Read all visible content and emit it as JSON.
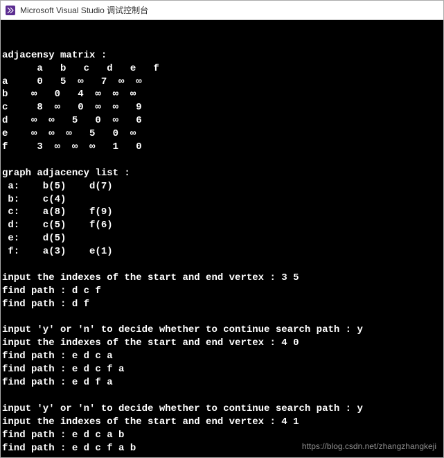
{
  "window": {
    "title": "Microsoft Visual Studio 调试控制台"
  },
  "console": {
    "lines": [
      "adjacensy matrix :",
      "      a   b   c   d   e   f",
      "a     0   5  ∞   7  ∞  ∞",
      "b    ∞   0   4  ∞  ∞  ∞",
      "c     8  ∞   0  ∞  ∞   9",
      "d    ∞  ∞   5   0  ∞   6",
      "e    ∞  ∞  ∞   5   0  ∞",
      "f     3  ∞  ∞  ∞   1   0",
      "",
      "graph adjacency list :",
      " a:    b(5)    d(7)",
      " b:    c(4)",
      " c:    a(8)    f(9)",
      " d:    c(5)    f(6)",
      " e:    d(5)",
      " f:    a(3)    e(1)",
      "",
      "input the indexes of the start and end vertex : 3 5",
      "find path : d c f",
      "find path : d f",
      "",
      "input 'y' or 'n' to decide whether to continue search path : y",
      "input the indexes of the start and end vertex : 4 0",
      "find path : e d c a",
      "find path : e d c f a",
      "find path : e d f a",
      "",
      "input 'y' or 'n' to decide whether to continue search path : y",
      "input the indexes of the start and end vertex : 4 1",
      "find path : e d c a b",
      "find path : e d c f a b"
    ]
  },
  "watermark": {
    "text": "https://blog.csdn.net/zhangzhangkeji"
  },
  "chart_data": {
    "type": "table",
    "adjacency_matrix": {
      "vertices": [
        "a",
        "b",
        "c",
        "d",
        "e",
        "f"
      ],
      "rows": [
        {
          "vertex": "a",
          "values": [
            0,
            5,
            "∞",
            7,
            "∞",
            "∞"
          ]
        },
        {
          "vertex": "b",
          "values": [
            "∞",
            0,
            4,
            "∞",
            "∞",
            "∞"
          ]
        },
        {
          "vertex": "c",
          "values": [
            8,
            "∞",
            0,
            "∞",
            "∞",
            9
          ]
        },
        {
          "vertex": "d",
          "values": [
            "∞",
            "∞",
            5,
            0,
            "∞",
            6
          ]
        },
        {
          "vertex": "e",
          "values": [
            "∞",
            "∞",
            "∞",
            5,
            0,
            "∞"
          ]
        },
        {
          "vertex": "f",
          "values": [
            3,
            "∞",
            "∞",
            "∞",
            1,
            0
          ]
        }
      ]
    },
    "adjacency_list": {
      "a": [
        {
          "to": "b",
          "w": 5
        },
        {
          "to": "d",
          "w": 7
        }
      ],
      "b": [
        {
          "to": "c",
          "w": 4
        }
      ],
      "c": [
        {
          "to": "a",
          "w": 8
        },
        {
          "to": "f",
          "w": 9
        }
      ],
      "d": [
        {
          "to": "c",
          "w": 5
        },
        {
          "to": "f",
          "w": 6
        }
      ],
      "e": [
        {
          "to": "d",
          "w": 5
        }
      ],
      "f": [
        {
          "to": "a",
          "w": 3
        },
        {
          "to": "e",
          "w": 1
        }
      ]
    },
    "queries": [
      {
        "start": 3,
        "end": 5,
        "paths": [
          [
            "d",
            "c",
            "f"
          ],
          [
            "d",
            "f"
          ]
        ]
      },
      {
        "continue": "y",
        "start": 4,
        "end": 0,
        "paths": [
          [
            "e",
            "d",
            "c",
            "a"
          ],
          [
            "e",
            "d",
            "c",
            "f",
            "a"
          ],
          [
            "e",
            "d",
            "f",
            "a"
          ]
        ]
      },
      {
        "continue": "y",
        "start": 4,
        "end": 1,
        "paths": [
          [
            "e",
            "d",
            "c",
            "a",
            "b"
          ],
          [
            "e",
            "d",
            "c",
            "f",
            "a",
            "b"
          ]
        ]
      }
    ]
  }
}
